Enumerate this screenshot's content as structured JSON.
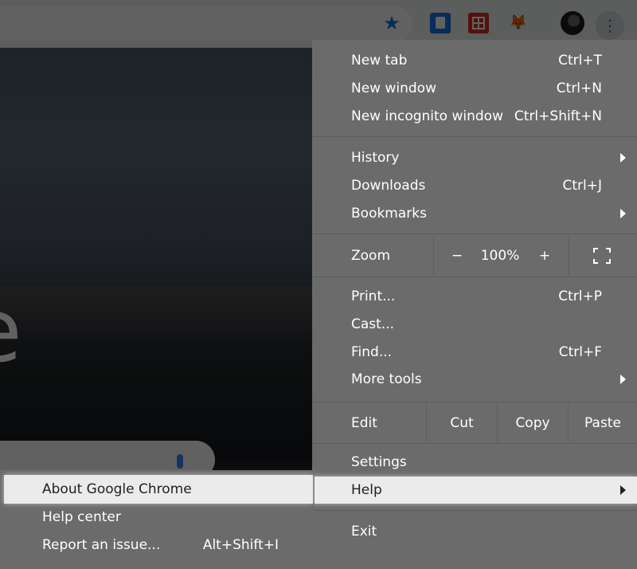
{
  "colors": {
    "accent": "#1a73e8",
    "menu_background": "#6b6b6b",
    "highlight": "#ebebeb"
  },
  "toolbar": {
    "icons": [
      "star-icon",
      "extension-icon",
      "extension-icon",
      "extension-icon",
      "profile-avatar",
      "more-vert-icon"
    ],
    "star_glyph": "★",
    "more_glyph": "⋮",
    "ext3_glyph": "🦊"
  },
  "page": {
    "logo_partial": "e"
  },
  "menu": {
    "items": [
      {
        "label": "New tab",
        "shortcut": "Ctrl+T"
      },
      {
        "label": "New window",
        "shortcut": "Ctrl+N"
      },
      {
        "label": "New incognito window",
        "shortcut": "Ctrl+Shift+N"
      },
      {
        "label": "History"
      },
      {
        "label": "Downloads",
        "shortcut": "Ctrl+J"
      },
      {
        "label": "Bookmarks"
      },
      {
        "label": "Print...",
        "shortcut": "Ctrl+P"
      },
      {
        "label": "Cast..."
      },
      {
        "label": "Find...",
        "shortcut": "Ctrl+F"
      },
      {
        "label": "More tools"
      },
      {
        "label": "Settings"
      },
      {
        "label": "Help"
      },
      {
        "label": "Exit"
      }
    ],
    "zoom": {
      "label": "Zoom",
      "minus": "−",
      "value": "100%",
      "plus": "+"
    },
    "edit": {
      "label": "Edit",
      "cut": "Cut",
      "copy": "Copy",
      "paste": "Paste"
    }
  },
  "help_submenu": {
    "items": [
      {
        "label": "About Google Chrome"
      },
      {
        "label": "Help center"
      },
      {
        "label": "Report an issue...",
        "shortcut": "Alt+Shift+I"
      }
    ]
  }
}
